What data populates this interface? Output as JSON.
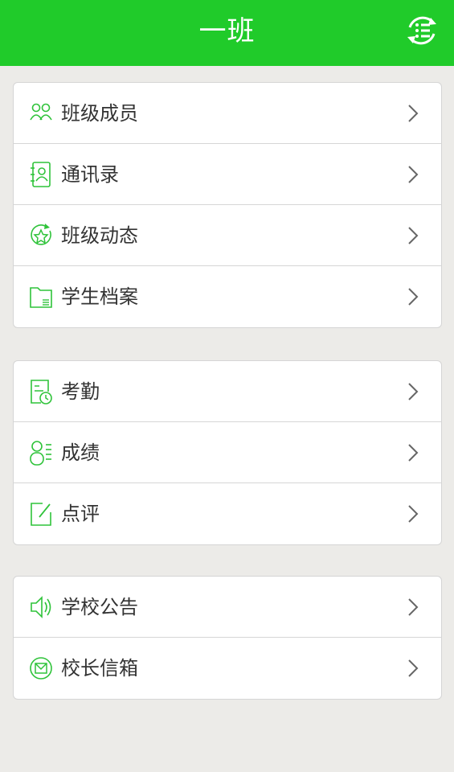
{
  "header": {
    "title": "一班"
  },
  "colors": {
    "accent": "#20cb2a",
    "background": "#ecebe8"
  },
  "groups": [
    {
      "items": [
        {
          "label": "班级成员",
          "icon": "members-icon"
        },
        {
          "label": "通讯录",
          "icon": "contacts-icon"
        },
        {
          "label": "班级动态",
          "icon": "class-news-icon"
        },
        {
          "label": "学生档案",
          "icon": "folder-icon"
        }
      ]
    },
    {
      "items": [
        {
          "label": "考勤",
          "icon": "attendance-icon"
        },
        {
          "label": "成绩",
          "icon": "grades-icon"
        },
        {
          "label": "点评",
          "icon": "review-icon"
        }
      ]
    },
    {
      "items": [
        {
          "label": "学校公告",
          "icon": "speaker-icon"
        },
        {
          "label": "校长信箱",
          "icon": "mailbox-icon"
        }
      ]
    }
  ]
}
